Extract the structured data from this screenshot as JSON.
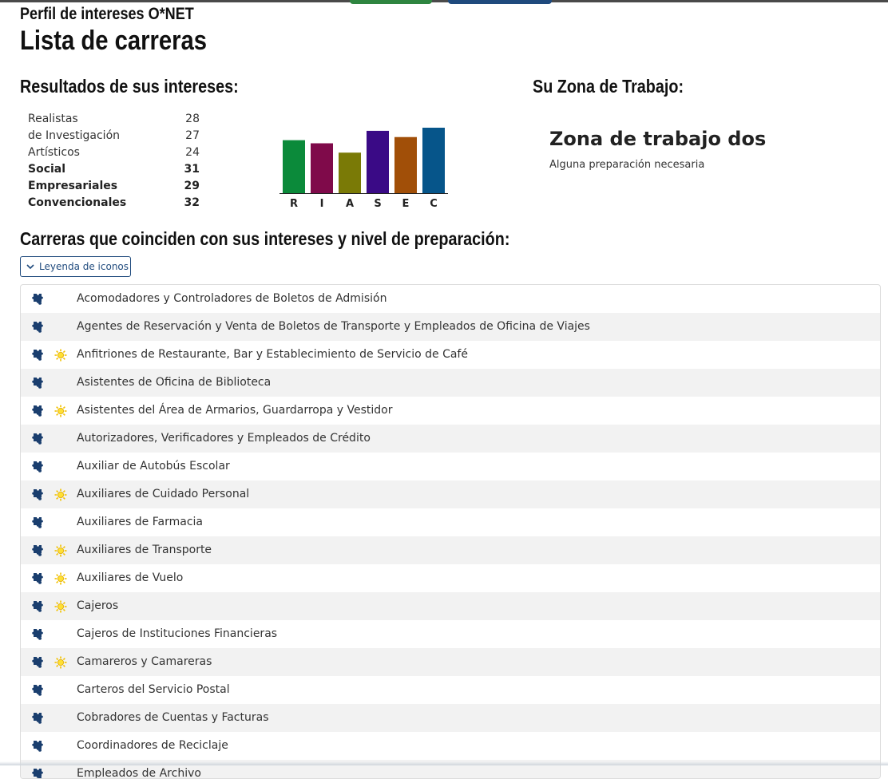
{
  "header": {
    "supertitle": "Perfil de intereses O*NET",
    "title": "Lista de carreras"
  },
  "results": {
    "heading": "Resultados de sus intereses:",
    "scores": [
      {
        "label": "Realistas",
        "value": "28",
        "bold": false
      },
      {
        "label": "de Investigación",
        "value": "27",
        "bold": false
      },
      {
        "label": "Artísticos",
        "value": "24",
        "bold": false
      },
      {
        "label": "Social",
        "value": "31",
        "bold": true
      },
      {
        "label": "Empresariales",
        "value": "29",
        "bold": true
      },
      {
        "label": "Convencionales",
        "value": "32",
        "bold": true
      }
    ]
  },
  "chart_data": {
    "type": "bar",
    "categories": [
      "R",
      "I",
      "A",
      "S",
      "E",
      "C"
    ],
    "values": [
      28,
      27,
      24,
      31,
      29,
      32
    ],
    "colors": [
      "#0b8a3a",
      "#7f0a4a",
      "#7a7a06",
      "#3a0a86",
      "#a14f08",
      "#06558a"
    ],
    "ylim": [
      0,
      40
    ],
    "grid": false
  },
  "zone": {
    "heading": "Su Zona de Trabajo:",
    "title": "Zona de trabajo dos",
    "subtitle": "Alguna preparación necesaria"
  },
  "careers": {
    "heading": "Carreras que coinciden con sus intereses y nivel de preparación:",
    "legend_button": "Leyenda de iconos",
    "items": [
      {
        "name": "Acomodadores y Controladores de Boletos de Admisión",
        "icons": [
          "puzzle-icon"
        ]
      },
      {
        "name": "Agentes de Reservación y Venta de Boletos de Transporte y Empleados de Oficina de Viajes",
        "icons": [
          "puzzle-icon"
        ]
      },
      {
        "name": "Anfitriones de Restaurante, Bar y Establecimiento de Servicio de Café",
        "icons": [
          "puzzle-icon",
          "sun-icon"
        ]
      },
      {
        "name": "Asistentes de Oficina de Biblioteca",
        "icons": [
          "puzzle-icon"
        ]
      },
      {
        "name": "Asistentes del Área de Armarios, Guardarropa y Vestidor",
        "icons": [
          "puzzle-icon",
          "sun-icon"
        ]
      },
      {
        "name": "Autorizadores, Verificadores y Empleados de Crédito",
        "icons": [
          "puzzle-icon"
        ]
      },
      {
        "name": "Auxiliar de Autobús Escolar",
        "icons": [
          "puzzle-icon"
        ]
      },
      {
        "name": "Auxiliares de Cuidado Personal",
        "icons": [
          "puzzle-icon",
          "sun-icon"
        ]
      },
      {
        "name": "Auxiliares de Farmacia",
        "icons": [
          "puzzle-icon"
        ]
      },
      {
        "name": "Auxiliares de Transporte",
        "icons": [
          "puzzle-icon",
          "sun-icon"
        ]
      },
      {
        "name": "Auxiliares de Vuelo",
        "icons": [
          "puzzle-icon",
          "sun-icon"
        ]
      },
      {
        "name": "Cajeros",
        "icons": [
          "puzzle-icon",
          "sun-icon"
        ]
      },
      {
        "name": "Cajeros de Instituciones Financieras",
        "icons": [
          "puzzle-icon"
        ]
      },
      {
        "name": "Camareros y Camareras",
        "icons": [
          "puzzle-icon",
          "sun-icon"
        ]
      },
      {
        "name": "Carteros del Servicio Postal",
        "icons": [
          "puzzle-icon"
        ]
      },
      {
        "name": "Cobradores de Cuentas y Facturas",
        "icons": [
          "puzzle-icon"
        ]
      },
      {
        "name": "Coordinadores de Reciclaje",
        "icons": [
          "puzzle-icon"
        ]
      },
      {
        "name": "Empleados de Archivo",
        "icons": [
          "puzzle-icon"
        ]
      }
    ]
  }
}
